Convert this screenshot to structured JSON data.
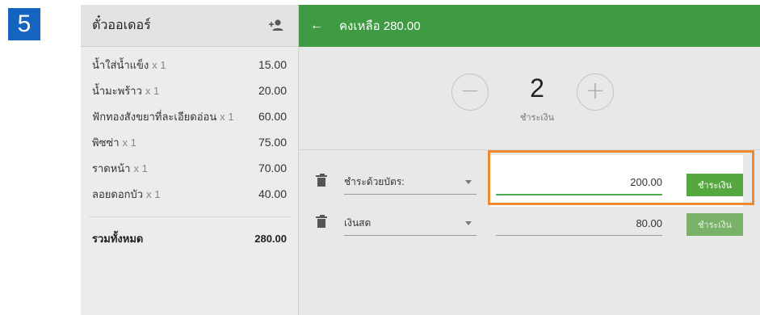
{
  "tutorial": {
    "step_number": "5"
  },
  "order": {
    "title": "ตั๋วออเดอร์",
    "add_customer_icon": "add-person-icon",
    "items": [
      {
        "name": "น้ำใส่น้ำแข็ง",
        "qty": "x 1",
        "price": "15.00"
      },
      {
        "name": "น้ำมะพร้าว",
        "qty": "x 1",
        "price": "20.00"
      },
      {
        "name": "ฟักทองสังขยาที่ละเอียดอ่อน",
        "qty": "x 1",
        "price": "60.00"
      },
      {
        "name": "พิซซ่า",
        "qty": "x 1",
        "price": "75.00"
      },
      {
        "name": "ราดหน้า",
        "qty": "x 1",
        "price": "70.00"
      },
      {
        "name": "ลอยดอกบัว",
        "qty": "x 1",
        "price": "40.00"
      }
    ],
    "total_label": "รวมทั้งหมด",
    "total_value": "280.00"
  },
  "payment": {
    "header_title": "คงเหลือ 280.00",
    "back_icon": "back-arrow-icon",
    "split": {
      "count": "2",
      "label": "ชำระเงิน",
      "minus": "−",
      "plus": "+"
    },
    "rows": [
      {
        "method": "ชำระด้วยบัตร:",
        "amount": "200.00",
        "button": "ชำระเงิน",
        "icon": "trash-icon"
      },
      {
        "method": "เงินสด",
        "amount": "80.00",
        "button": "ชำระเงิน",
        "icon": "trash-icon"
      }
    ]
  },
  "colors": {
    "header_green": "#3f9a44",
    "button_green": "#55a83f",
    "highlight_orange": "#f08a2e",
    "step_blue": "#1565c0"
  }
}
